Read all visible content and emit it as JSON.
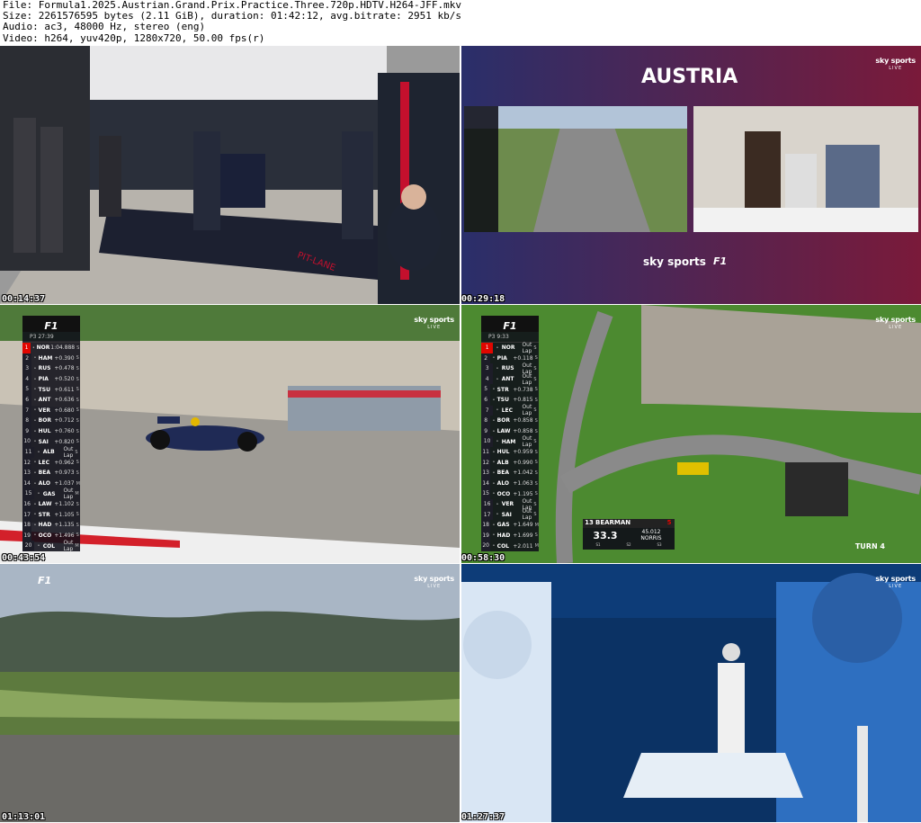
{
  "header": {
    "file": "File: Formula1.2025.Austrian.Grand.Prix.Practice.Three.720p.HDTV.H264-JFF.mkv",
    "size": "Size: 2261576595 bytes (2.11 GiB), duration: 01:42:12, avg.bitrate: 2951 kb/s",
    "audio": "Audio: ac3, 48000 Hz, stereo (eng)",
    "video": "Video: h264, yuv420p, 1280x720, 50.00 fps(r)"
  },
  "frames": [
    {
      "timestamp": "00:14:37"
    },
    {
      "timestamp": "00:29:18",
      "banner": "AUSTRIA",
      "broadcaster": "sky sports"
    },
    {
      "timestamp": "00:43:54",
      "session": "P3 27:39"
    },
    {
      "timestamp": "00:58:30",
      "session": "P3 9:33",
      "turn": "TURN 4"
    },
    {
      "timestamp": "01:13:01"
    },
    {
      "timestamp": "01:27:37"
    }
  ],
  "sky_logo": {
    "line1": "sky sports",
    "line2": "LIVE"
  },
  "f1_logo": "F1",
  "pitlane_text": "PIT-LANE",
  "tower3": [
    {
      "p": "1",
      "c": "NOR",
      "g": "1:04.888",
      "t": "S"
    },
    {
      "p": "2",
      "c": "HAM",
      "g": "+0.390",
      "t": "S"
    },
    {
      "p": "3",
      "c": "RUS",
      "g": "+0.478",
      "t": "S"
    },
    {
      "p": "4",
      "c": "PIA",
      "g": "+0.520",
      "t": "S"
    },
    {
      "p": "5",
      "c": "TSU",
      "g": "+0.611",
      "t": "S"
    },
    {
      "p": "6",
      "c": "ANT",
      "g": "+0.636",
      "t": "S"
    },
    {
      "p": "7",
      "c": "VER",
      "g": "+0.680",
      "t": "S"
    },
    {
      "p": "8",
      "c": "BOR",
      "g": "+0.712",
      "t": "S"
    },
    {
      "p": "9",
      "c": "HUL",
      "g": "+0.760",
      "t": "S"
    },
    {
      "p": "10",
      "c": "SAI",
      "g": "+0.820",
      "t": "S"
    },
    {
      "p": "11",
      "c": "ALB",
      "g": "Out Lap",
      "t": "S"
    },
    {
      "p": "12",
      "c": "LEC",
      "g": "+0.962",
      "t": "S"
    },
    {
      "p": "13",
      "c": "BEA",
      "g": "+0.973",
      "t": "S"
    },
    {
      "p": "14",
      "c": "ALO",
      "g": "+1.037",
      "t": "M"
    },
    {
      "p": "15",
      "c": "GAS",
      "g": "Out Lap",
      "t": "M"
    },
    {
      "p": "16",
      "c": "LAW",
      "g": "+1.102",
      "t": "S"
    },
    {
      "p": "17",
      "c": "STR",
      "g": "+1.105",
      "t": "S"
    },
    {
      "p": "18",
      "c": "HAD",
      "g": "+1.135",
      "t": "S"
    },
    {
      "p": "19",
      "c": "OCO",
      "g": "+1.496",
      "t": "S"
    },
    {
      "p": "20",
      "c": "COL",
      "g": "Out Lap",
      "t": "M"
    }
  ],
  "tower4": [
    {
      "p": "1",
      "c": "NOR",
      "g": "Out Lap",
      "t": "S"
    },
    {
      "p": "2",
      "c": "PIA",
      "g": "+0.118",
      "t": "S"
    },
    {
      "p": "3",
      "c": "RUS",
      "g": "Out Lap",
      "t": "S"
    },
    {
      "p": "4",
      "c": "ANT",
      "g": "Out Lap",
      "t": "S"
    },
    {
      "p": "5",
      "c": "STR",
      "g": "+0.738",
      "t": "S"
    },
    {
      "p": "6",
      "c": "TSU",
      "g": "+0.815",
      "t": "S"
    },
    {
      "p": "7",
      "c": "LEC",
      "g": "Out Lap",
      "t": "S"
    },
    {
      "p": "8",
      "c": "BOR",
      "g": "+0.858",
      "t": "S"
    },
    {
      "p": "9",
      "c": "LAW",
      "g": "+0.858",
      "t": "S"
    },
    {
      "p": "10",
      "c": "HAM",
      "g": "Out Lap",
      "t": "S"
    },
    {
      "p": "11",
      "c": "HUL",
      "g": "+0.959",
      "t": "S"
    },
    {
      "p": "12",
      "c": "ALB",
      "g": "+0.990",
      "t": "S"
    },
    {
      "p": "13",
      "c": "BEA",
      "g": "+1.042",
      "t": "S"
    },
    {
      "p": "14",
      "c": "ALO",
      "g": "+1.063",
      "t": "S"
    },
    {
      "p": "15",
      "c": "OCO",
      "g": "+1.195",
      "t": "S"
    },
    {
      "p": "16",
      "c": "VER",
      "g": "Out Lap",
      "t": "S"
    },
    {
      "p": "17",
      "c": "SAI",
      "g": "Out Lap",
      "t": "S"
    },
    {
      "p": "18",
      "c": "GAS",
      "g": "+1.649",
      "t": "M"
    },
    {
      "p": "19",
      "c": "HAD",
      "g": "+1.699",
      "t": "S"
    },
    {
      "p": "20",
      "c": "COL",
      "g": "+2.011",
      "t": "M"
    }
  ],
  "onboard": {
    "pos": "13",
    "name": "BEARMAN",
    "lap": "33.3",
    "ref_time": "45.012",
    "ref_driver": "NORRIS",
    "sectors": [
      "S1",
      "S2",
      "S3"
    ]
  }
}
